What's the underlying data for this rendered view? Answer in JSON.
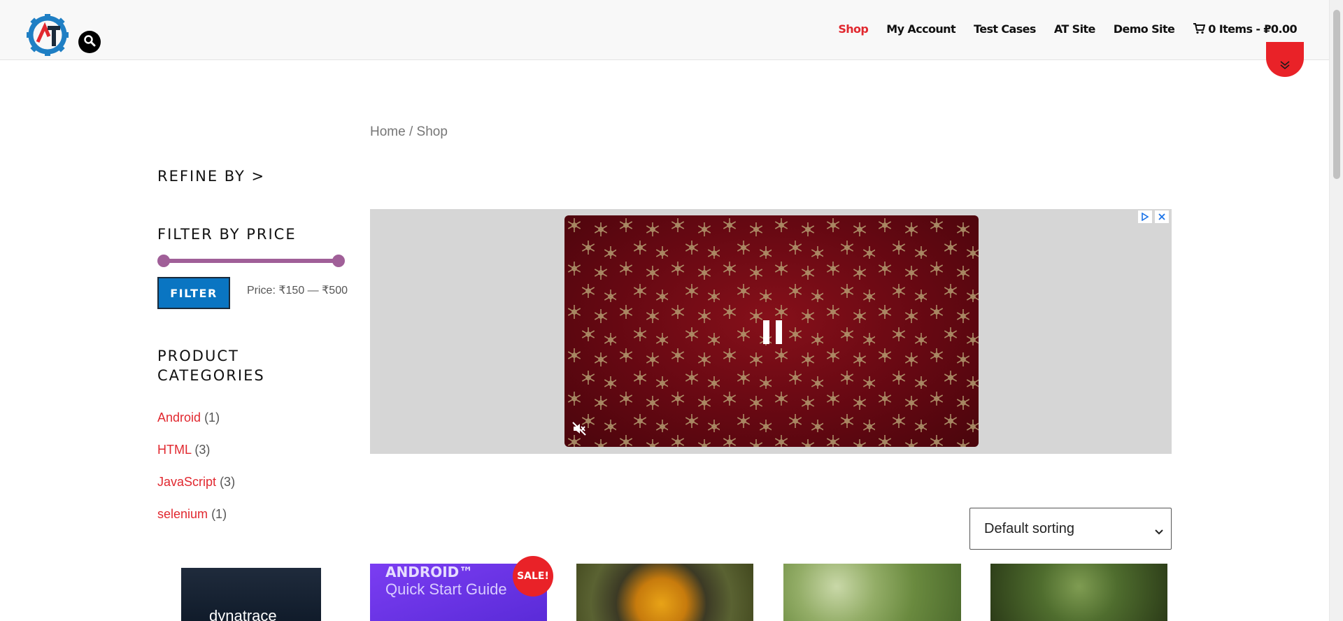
{
  "header": {
    "nav": [
      {
        "label": "Shop",
        "active": true
      },
      {
        "label": "My Account",
        "active": false
      },
      {
        "label": "Test Cases",
        "active": false
      },
      {
        "label": "AT Site",
        "active": false
      },
      {
        "label": "Demo Site",
        "active": false
      }
    ],
    "cart_label": "0 Items - ₽0.00"
  },
  "breadcrumb": "Home / Shop",
  "sidebar": {
    "refine_title": "REFINE BY >",
    "price_title": "FILTER BY PRICE",
    "filter_button": "FILTER",
    "price_label": "Price: ₹150 — ₹500",
    "categories_title_line1": "PRODUCT",
    "categories_title_line2": "CATEGORIES",
    "categories": [
      {
        "name": "Android",
        "count": "(1)"
      },
      {
        "name": "HTML",
        "count": "(3)"
      },
      {
        "name": "JavaScript",
        "count": "(3)"
      },
      {
        "name": "selenium",
        "count": "(1)"
      }
    ]
  },
  "sort": {
    "selected": "Default sorting"
  },
  "products": {
    "sale_badge": "SALE!",
    "p1_text": "dynatrace",
    "p2_line1": "ANDROID™",
    "p2_line2": "Quick Start Guide"
  },
  "colors": {
    "accent": "#e1282f",
    "filter_button": "#0a75c2",
    "slider": "#a05f98"
  }
}
